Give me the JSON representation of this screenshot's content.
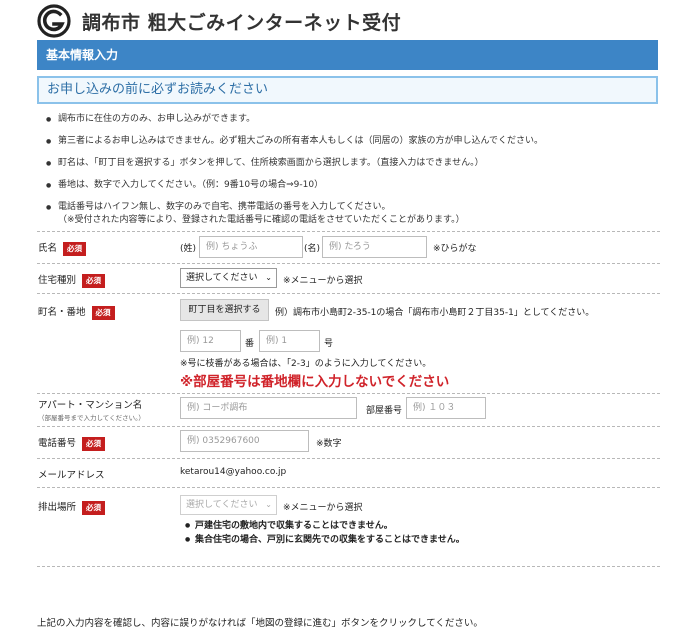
{
  "header": {
    "title": "調布市 粗大ごみインターネット受付",
    "logo_icon": "chofu-city-logo-icon"
  },
  "section": {
    "title": "基本情報入力",
    "notice_title": "お申し込みの前に必ずお読みください",
    "notes": [
      "調布市に在住の方のみ、お申し込みができます。",
      "第三者によるお申し込みはできません。必ず粗大ごみの所有者本人もしくは（同居の）家族の方が申し込んでください。",
      "町名は、「町丁目を選択する」ボタンを押して、住所検索画面から選択します。（直接入力はできません。）",
      "番地は、数字で入力してください。（例：9番10号の場合⇒9-10）",
      "電話番号はハイフン無し、数字のみで自宅、携帯電話の番号を入力してください。\n（※受付された内容等により、登録された電話番号に確認の電話をさせていただくことがあります。）"
    ]
  },
  "form": {
    "required_badge": "必須",
    "name": {
      "label": "氏名",
      "sei_prefix": "(姓)",
      "sei_placeholder": "例) ちょうふ",
      "mei_prefix": "(名)",
      "mei_placeholder": "例) たろう",
      "hint": "※ひらがな"
    },
    "housing": {
      "label": "住宅種別",
      "selected": "選択してください",
      "hint": "※メニューから選択"
    },
    "address": {
      "label": "町名・番地",
      "button": "町丁目を選択する",
      "example": "例）調布市小島町2-35-1の場合「調布市小島町２丁目35-1」としてください。",
      "ban_placeholder": "例) 12",
      "ban_suffix": "番",
      "go_placeholder": "例) 1",
      "go_suffix": "号",
      "branch_note": "※号に枝番がある場合は、「2-3」のように入力してください。",
      "warning": "※部屋番号は番地欄に入力しないでください"
    },
    "apartment": {
      "label": "アパート・マンション名",
      "sublabel": "（部屋番号まで入力してください。）",
      "name_placeholder": "例) コーポ調布",
      "room_label": "部屋番号",
      "room_placeholder": "例) １０３"
    },
    "phone": {
      "label": "電話番号",
      "placeholder": "例) 0352967600",
      "hint": "※数字"
    },
    "email": {
      "label": "メールアドレス",
      "value": "ketarou14@yahoo.co.jp"
    },
    "place": {
      "label": "排出場所",
      "selected": "選択してください",
      "hint": "※メニューから選択",
      "notes": [
        "戸建住宅の敷地内で収集することはできません。",
        "集合住宅の場合、戸別に玄関先での収集をすることはできません。"
      ]
    }
  },
  "footer": {
    "instruction": "上記の入力内容を確認し、内容に誤りがなければ「地図の登録に進む」ボタンをクリックしてください。"
  }
}
